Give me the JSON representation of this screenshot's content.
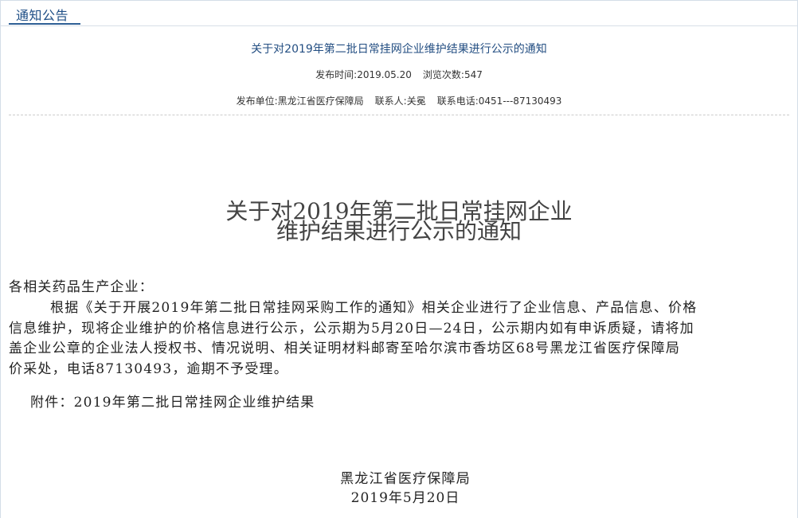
{
  "section": {
    "title": "通知公告"
  },
  "notice": {
    "title": "关于对2019年第二批日常挂网企业维护结果进行公示的通知",
    "publish_time_label": "发布时间:",
    "publish_time": "2019.05.20",
    "views_label": "浏览次数:",
    "views": "547",
    "publisher_label": "发布单位:",
    "publisher": "黑龙江省医疗保障局",
    "contact_label": "联系人:",
    "contact": "关冕",
    "phone_label": "联系电话:",
    "phone": "0451---87130493"
  },
  "document": {
    "title_line_1": "关于对2019年第二批日常挂网企业",
    "title_line_2": "维护结果进行公示的通知",
    "salutation": "各相关药品生产企业：",
    "body_lines": [
      "根据《关于开展2019年第二批日常挂网采购工作的通知》相关企业进行了企业信息、产品信息、价格",
      "信息维护，现将企业维护的价格信息进行公示，公示期为5月20日—24日，公示期内如有申诉质疑，请将加",
      "盖企业公章的企业法人授权书、情况说明、相关证明材料邮寄至哈尔滨市香坊区68号黑龙江省医疗保障局",
      "价采处，电话87130493，逾期不予受理。"
    ],
    "attachment": "附件：2019年第二批日常挂网企业维护结果",
    "signature_org": "黑龙江省医疗保障局",
    "signature_date": "2019年5月20日"
  }
}
